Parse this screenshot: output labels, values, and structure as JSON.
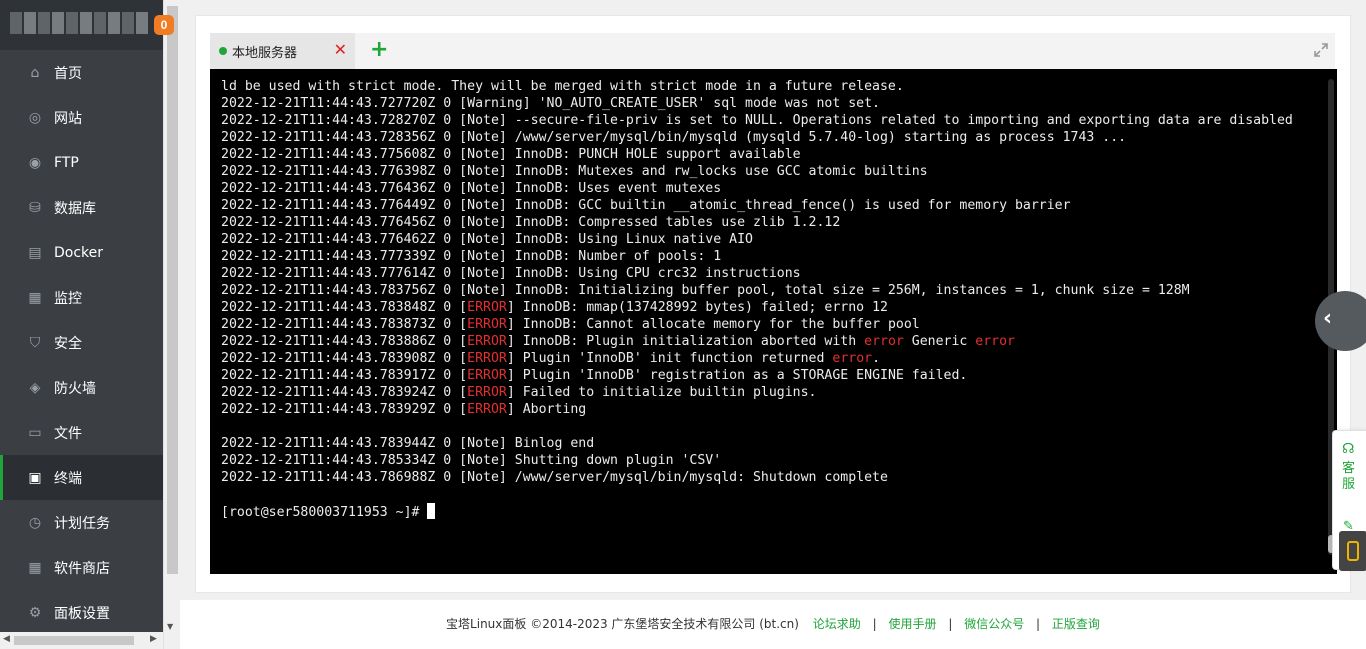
{
  "sidebar": {
    "badge": "0",
    "items": [
      {
        "label": "首页",
        "icon": "home-icon",
        "glyph": "⌂"
      },
      {
        "label": "网站",
        "icon": "globe-icon",
        "glyph": "◎"
      },
      {
        "label": "FTP",
        "icon": "ftp-icon",
        "glyph": "◉"
      },
      {
        "label": "数据库",
        "icon": "database-icon",
        "glyph": "⛁"
      },
      {
        "label": "Docker",
        "icon": "docker-icon",
        "glyph": "▤"
      },
      {
        "label": "监控",
        "icon": "monitor-icon",
        "glyph": "▦"
      },
      {
        "label": "安全",
        "icon": "shield-check-icon",
        "glyph": "⛉"
      },
      {
        "label": "防火墙",
        "icon": "firewall-shield-icon",
        "glyph": "◈"
      },
      {
        "label": "文件",
        "icon": "folder-icon",
        "glyph": "▭"
      },
      {
        "label": "终端",
        "icon": "terminal-icon",
        "glyph": "▣"
      },
      {
        "label": "计划任务",
        "icon": "clock-icon",
        "glyph": "◷"
      },
      {
        "label": "软件商店",
        "icon": "apps-grid-icon",
        "glyph": "▦"
      },
      {
        "label": "面板设置",
        "icon": "gear-icon",
        "glyph": "⚙"
      }
    ]
  },
  "tabs": {
    "active_label": "本地服务器",
    "close_glyph": "✕",
    "add_glyph": "+"
  },
  "terminal": {
    "lines": [
      {
        "parts": [
          {
            "t": "ld be used with strict mode. They will be merged with strict mode in a future release."
          }
        ]
      },
      {
        "parts": [
          {
            "t": "2022-12-21T11:44:43.727720Z 0 [Warning] 'NO_AUTO_CREATE_USER' sql mode was not set."
          }
        ]
      },
      {
        "parts": [
          {
            "t": "2022-12-21T11:44:43.728270Z 0 [Note] --secure-file-priv is set to NULL. Operations related to importing and exporting data are disabled"
          }
        ]
      },
      {
        "parts": [
          {
            "t": "2022-12-21T11:44:43.728356Z 0 [Note] /www/server/mysql/bin/mysqld (mysqld 5.7.40-log) starting as process 1743 ..."
          }
        ]
      },
      {
        "parts": [
          {
            "t": "2022-12-21T11:44:43.775608Z 0 [Note] InnoDB: PUNCH HOLE support available"
          }
        ]
      },
      {
        "parts": [
          {
            "t": "2022-12-21T11:44:43.776398Z 0 [Note] InnoDB: Mutexes and rw_locks use GCC atomic builtins"
          }
        ]
      },
      {
        "parts": [
          {
            "t": "2022-12-21T11:44:43.776436Z 0 [Note] InnoDB: Uses event mutexes"
          }
        ]
      },
      {
        "parts": [
          {
            "t": "2022-12-21T11:44:43.776449Z 0 [Note] InnoDB: GCC builtin __atomic_thread_fence() is used for memory barrier"
          }
        ]
      },
      {
        "parts": [
          {
            "t": "2022-12-21T11:44:43.776456Z 0 [Note] InnoDB: Compressed tables use zlib 1.2.12"
          }
        ]
      },
      {
        "parts": [
          {
            "t": "2022-12-21T11:44:43.776462Z 0 [Note] InnoDB: Using Linux native AIO"
          }
        ]
      },
      {
        "parts": [
          {
            "t": "2022-12-21T11:44:43.777339Z 0 [Note] InnoDB: Number of pools: 1"
          }
        ]
      },
      {
        "parts": [
          {
            "t": "2022-12-21T11:44:43.777614Z 0 [Note] InnoDB: Using CPU crc32 instructions"
          }
        ]
      },
      {
        "parts": [
          {
            "t": "2022-12-21T11:44:43.783756Z 0 [Note] InnoDB: Initializing buffer pool, total size = 256M, instances = 1, chunk size = 128M"
          }
        ]
      },
      {
        "parts": [
          {
            "t": "2022-12-21T11:44:43.783848Z 0 ["
          },
          {
            "t": "ERROR",
            "e": true
          },
          {
            "t": "] InnoDB: mmap(137428992 bytes) failed; errno 12"
          }
        ]
      },
      {
        "parts": [
          {
            "t": "2022-12-21T11:44:43.783873Z 0 ["
          },
          {
            "t": "ERROR",
            "e": true
          },
          {
            "t": "] InnoDB: Cannot allocate memory for the buffer pool"
          }
        ]
      },
      {
        "parts": [
          {
            "t": "2022-12-21T11:44:43.783886Z 0 ["
          },
          {
            "t": "ERROR",
            "e": true
          },
          {
            "t": "] InnoDB: Plugin initialization aborted with "
          },
          {
            "t": "error",
            "e": true
          },
          {
            "t": " Generic "
          },
          {
            "t": "error",
            "e": true
          }
        ]
      },
      {
        "parts": [
          {
            "t": "2022-12-21T11:44:43.783908Z 0 ["
          },
          {
            "t": "ERROR",
            "e": true
          },
          {
            "t": "] Plugin 'InnoDB' init function returned "
          },
          {
            "t": "error",
            "e": true
          },
          {
            "t": "."
          }
        ]
      },
      {
        "parts": [
          {
            "t": "2022-12-21T11:44:43.783917Z 0 ["
          },
          {
            "t": "ERROR",
            "e": true
          },
          {
            "t": "] Plugin 'InnoDB' registration as a STORAGE ENGINE failed."
          }
        ]
      },
      {
        "parts": [
          {
            "t": "2022-12-21T11:44:43.783924Z 0 ["
          },
          {
            "t": "ERROR",
            "e": true
          },
          {
            "t": "] Failed to initialize builtin plugins."
          }
        ]
      },
      {
        "parts": [
          {
            "t": "2022-12-21T11:44:43.783929Z 0 ["
          },
          {
            "t": "ERROR",
            "e": true
          },
          {
            "t": "] Aborting"
          }
        ]
      },
      {
        "parts": [
          {
            "t": ""
          }
        ]
      },
      {
        "parts": [
          {
            "t": "2022-12-21T11:44:43.783944Z 0 [Note] Binlog end"
          }
        ]
      },
      {
        "parts": [
          {
            "t": "2022-12-21T11:44:43.785334Z 0 [Note] Shutting down plugin 'CSV'"
          }
        ]
      },
      {
        "parts": [
          {
            "t": "2022-12-21T11:44:43.786988Z 0 [Note] /www/server/mysql/bin/mysqld: Shutdown complete"
          }
        ]
      },
      {
        "parts": [
          {
            "t": ""
          }
        ]
      }
    ],
    "prompt": "[root@ser580003711953 ~]# "
  },
  "float_service": {
    "label": "客服"
  },
  "footer": {
    "copyright": "宝塔Linux面板 ©2014-2023 广东堡塔安全技术有限公司 (bt.cn)",
    "links": [
      "论坛求助",
      "使用手册",
      "微信公众号",
      "正版查询"
    ],
    "separator": "|"
  },
  "colors": {
    "accent": "#20a53a",
    "error": "#e03030",
    "sidebar_bg": "#3b3f44",
    "badge": "#f07c24"
  }
}
